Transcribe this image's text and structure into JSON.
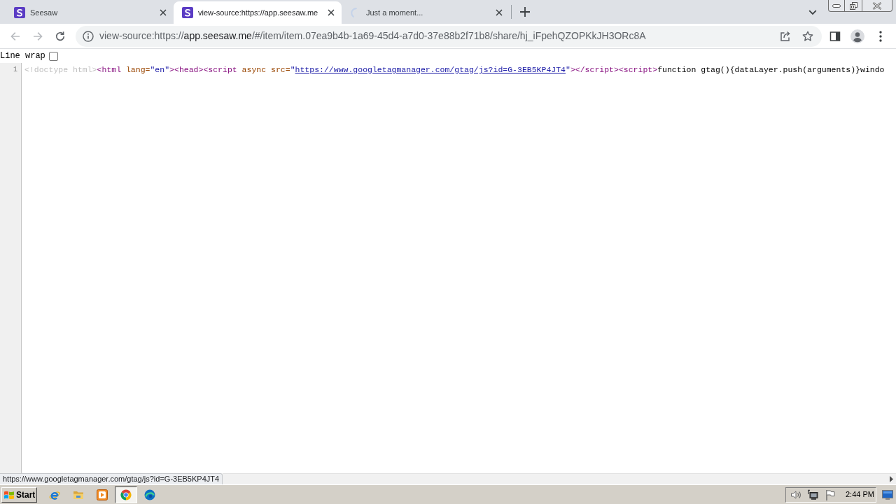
{
  "tabs": [
    {
      "title": "Seesaw",
      "selected": false,
      "loading": false
    },
    {
      "title": "view-source:https://app.seesaw.me",
      "selected": true,
      "loading": false
    },
    {
      "title": "Just a moment...",
      "selected": false,
      "loading": true
    }
  ],
  "toolbar": {
    "nav_buttons": [
      {
        "kind": "back",
        "disabled": true
      },
      {
        "kind": "forward",
        "disabled": true
      },
      {
        "kind": "reload",
        "disabled": false
      }
    ],
    "address": {
      "scheme": "view-source:https://",
      "host": "app.seesaw.me",
      "path": "/#/item/item.07ea9b4b-1a69-45d4-a7d0-37e88b2f71b8/share/hj_iFpehQZOPKkJH3ORc8A"
    }
  },
  "line_wrap": {
    "label": "Line wrap",
    "checked": false
  },
  "source": {
    "lines": [
      {
        "number": "1",
        "tokens": [
          {
            "kind": "doctype",
            "text": "<!doctype html>"
          },
          {
            "kind": "tag",
            "text": "<html"
          },
          {
            "kind": "attribute",
            "text": " lang="
          },
          {
            "kind": "value",
            "text": "\"en\""
          },
          {
            "kind": "tag",
            "text": "><head><script"
          },
          {
            "kind": "attribute",
            "text": " async src="
          },
          {
            "kind": "value",
            "text": "\""
          },
          {
            "kind": "link",
            "text": "https://www.googletagmanager.com/gtag/js?id=G-3EB5KP4JT4"
          },
          {
            "kind": "value",
            "text": "\""
          },
          {
            "kind": "tag",
            "text": "></script><script>"
          },
          {
            "kind": "text",
            "text": "function gtag(){dataLayer.push(arguments)}windo"
          }
        ]
      }
    ]
  },
  "status_bubble": "https://www.googletagmanager.com/gtag/js?id=G-3EB5KP4JT4",
  "taskbar": {
    "start_label": "Start",
    "apps": [
      {
        "kind": "ie",
        "selected": false
      },
      {
        "kind": "folder",
        "selected": false
      },
      {
        "kind": "media",
        "selected": false
      },
      {
        "kind": "chrome",
        "selected": true
      },
      {
        "kind": "edge",
        "selected": false
      }
    ],
    "clock": "2:44 PM"
  }
}
